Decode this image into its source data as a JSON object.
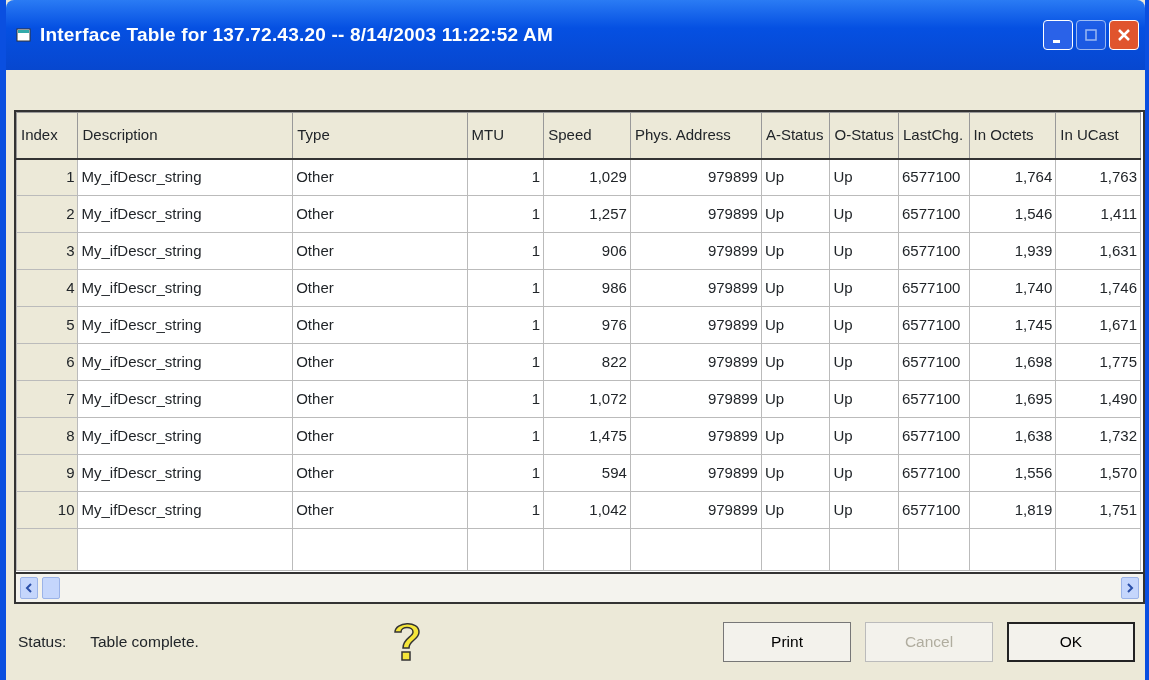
{
  "window": {
    "title": "Interface Table for 137.72.43.20 -- 8/14/2003 11:22:52 AM"
  },
  "table": {
    "columns": [
      "Index",
      "Description",
      "Type",
      "MTU",
      "Speed",
      "Phys. Address",
      "A-Status",
      "O-Status",
      "LastChg.",
      "In Octets",
      "In UCast"
    ],
    "rows": [
      [
        "1",
        "My_ifDescr_string",
        "Other",
        "1",
        "1,029",
        "979899",
        "Up",
        "Up",
        "6577100",
        "1,764",
        "1,763"
      ],
      [
        "2",
        "My_ifDescr_string",
        "Other",
        "1",
        "1,257",
        "979899",
        "Up",
        "Up",
        "6577100",
        "1,546",
        "1,411"
      ],
      [
        "3",
        "My_ifDescr_string",
        "Other",
        "1",
        "906",
        "979899",
        "Up",
        "Up",
        "6577100",
        "1,939",
        "1,631"
      ],
      [
        "4",
        "My_ifDescr_string",
        "Other",
        "1",
        "986",
        "979899",
        "Up",
        "Up",
        "6577100",
        "1,740",
        "1,746"
      ],
      [
        "5",
        "My_ifDescr_string",
        "Other",
        "1",
        "976",
        "979899",
        "Up",
        "Up",
        "6577100",
        "1,745",
        "1,671"
      ],
      [
        "6",
        "My_ifDescr_string",
        "Other",
        "1",
        "822",
        "979899",
        "Up",
        "Up",
        "6577100",
        "1,698",
        "1,775"
      ],
      [
        "7",
        "My_ifDescr_string",
        "Other",
        "1",
        "1,072",
        "979899",
        "Up",
        "Up",
        "6577100",
        "1,695",
        "1,490"
      ],
      [
        "8",
        "My_ifDescr_string",
        "Other",
        "1",
        "1,475",
        "979899",
        "Up",
        "Up",
        "6577100",
        "1,638",
        "1,732"
      ],
      [
        "9",
        "My_ifDescr_string",
        "Other",
        "1",
        "594",
        "979899",
        "Up",
        "Up",
        "6577100",
        "1,556",
        "1,570"
      ],
      [
        "10",
        "My_ifDescr_string",
        "Other",
        "1",
        "1,042",
        "979899",
        "Up",
        "Up",
        "6577100",
        "1,819",
        "1,751"
      ]
    ]
  },
  "status_bar": {
    "label": "Status:",
    "text": "Table complete."
  },
  "buttons": [
    {
      "label": "Print",
      "disabled": false
    },
    {
      "label": "Cancel",
      "disabled": true
    },
    {
      "label": "OK",
      "disabled": false
    }
  ]
}
